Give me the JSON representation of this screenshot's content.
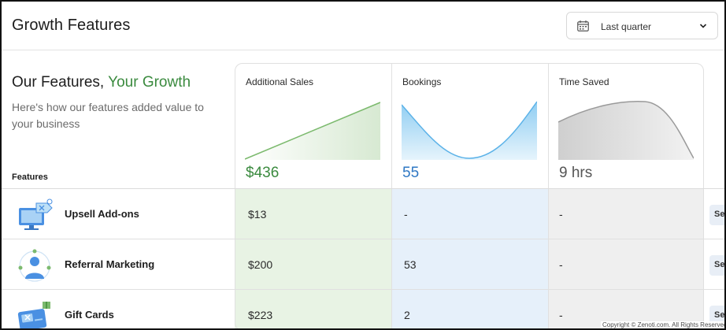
{
  "header": {
    "title": "Growth Features",
    "date_range": {
      "selected": "Last quarter"
    }
  },
  "intro": {
    "heading_main": "Our Features, ",
    "heading_accent": "Your Growth",
    "subtitle": "Here's how our features added value to your business",
    "features_column_label": "Features"
  },
  "metrics": [
    {
      "name": "Additional Sales",
      "value": "$436",
      "color": "#3a8a3e",
      "chart_fill": "#e3f0e0",
      "chart_line": "#7cba6e"
    },
    {
      "name": "Bookings",
      "value": "55",
      "color": "#2f78c4",
      "chart_fill": "#bfe1f7",
      "chart_line": "#5bb2e8"
    },
    {
      "name": "Time Saved",
      "value": "9 hrs",
      "color": "#555555",
      "chart_fill": "#d6d6d6",
      "chart_line": "#9a9a9a"
    }
  ],
  "column_backgrounds": [
    "#e8f3e4",
    "#e6f0fa",
    "#efefef"
  ],
  "features": [
    {
      "name": "Upsell Add-ons",
      "icon": "monitor-tag-icon",
      "sales": "$13",
      "bookings": "-",
      "time_saved": "-",
      "action_label": "Se"
    },
    {
      "name": "Referral Marketing",
      "icon": "referral-people-icon",
      "sales": "$200",
      "bookings": "53",
      "time_saved": "-",
      "action_label": "Se"
    },
    {
      "name": "Gift Cards",
      "icon": "gift-card-icon",
      "sales": "$223",
      "bookings": "2",
      "time_saved": "-",
      "action_label": "Se"
    }
  ],
  "footer": {
    "copyright": "Copyright © Zenoti.com. All Rights Reserved."
  }
}
